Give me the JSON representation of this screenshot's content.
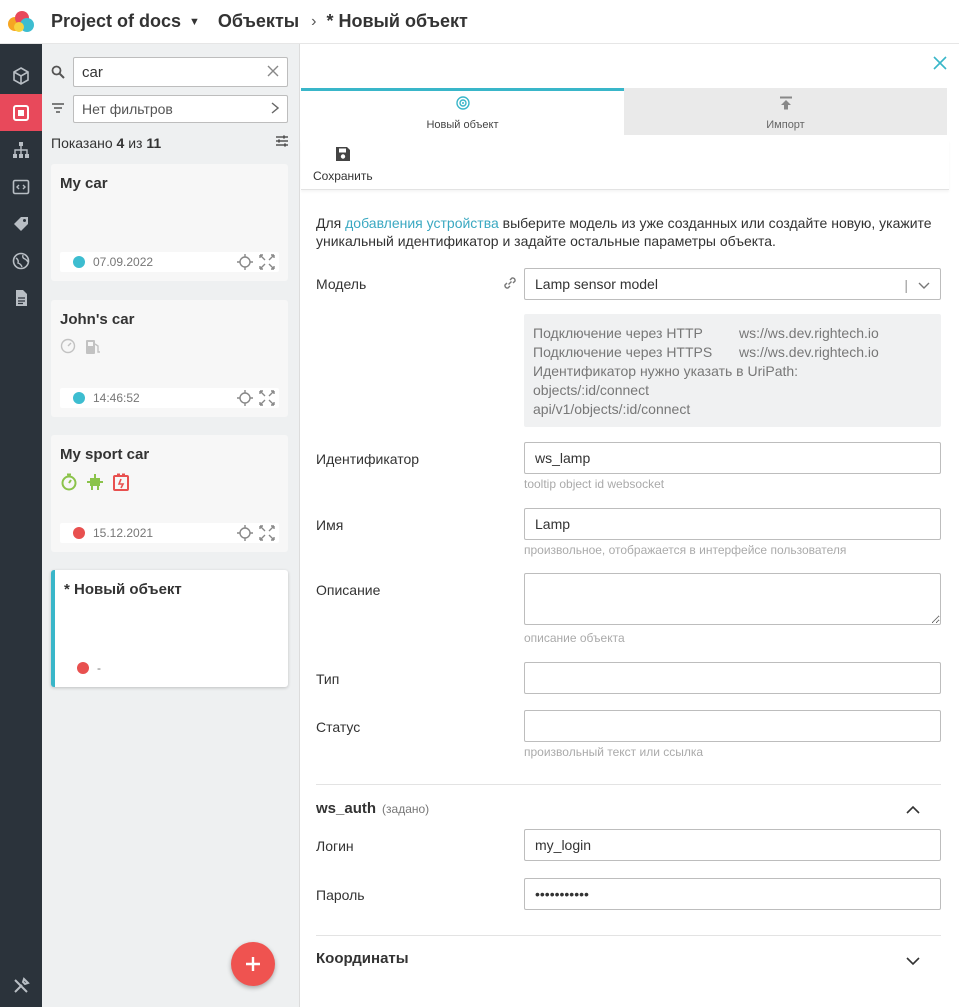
{
  "topbar": {
    "project": "Project of docs",
    "crumb": "Объекты",
    "current": "* Новый объект"
  },
  "list": {
    "search_value": "car",
    "filter_label": "Нет фильтров",
    "shown_prefix": "Показано",
    "shown_count": "4",
    "shown_of": "из",
    "shown_total": "11",
    "cards": [
      {
        "title": "My car",
        "date": "07.09.2022",
        "status_color": "#3dbdd0"
      },
      {
        "title": "John's car",
        "date": "14:46:52",
        "status_color": "#3dbdd0"
      },
      {
        "title": "My sport car",
        "date": "15.12.2021",
        "status_color": "#e8504f"
      },
      {
        "title": "* Новый объект",
        "date": "-",
        "status_color": "#e8504f"
      }
    ]
  },
  "tabs": {
    "new": "Новый объект",
    "import": "Импорт"
  },
  "toolbar": {
    "save_label": "Сохранить"
  },
  "intro": {
    "prefix": "Для ",
    "link": "добавления устройства",
    "rest": " выберите модель из уже созданных или создайте новую, укажите уникальный идентификатор и задайте остальные параметры объекта."
  },
  "form": {
    "model_label": "Модель",
    "model_value": "Lamp sensor model",
    "info": {
      "http_label": "Подключение через HTTP",
      "http_value": "ws://ws.dev.rightech.io",
      "https_label": "Подключение через HTTPS",
      "https_value": "ws://ws.dev.rightech.io",
      "note": "Идентификатор нужно указать в UriPath:",
      "path1": "objects/:id/connect",
      "path2": "api/v1/objects/:id/connect"
    },
    "id_label": "Идентификатор",
    "id_value": "ws_lamp",
    "id_hint": "tooltip object id websocket",
    "name_label": "Имя",
    "name_value": "Lamp",
    "name_hint": "произвольное, отображается в интерфейсе пользователя",
    "desc_label": "Описание",
    "desc_hint": "описание объекта",
    "type_label": "Тип",
    "status_label": "Статус",
    "status_hint": "произвольный текст или ссылка",
    "ws_auth_title": "ws_auth",
    "ws_auth_sub": "(задано)",
    "login_label": "Логин",
    "login_value": "my_login",
    "password_label": "Пароль",
    "password_value": "•••••••••••",
    "coords_title": "Координаты"
  },
  "colors": {
    "accent": "#39b6c9",
    "nav_bg": "#2b333b",
    "nav_active": "#e8495b",
    "fab": "#ef5350"
  }
}
